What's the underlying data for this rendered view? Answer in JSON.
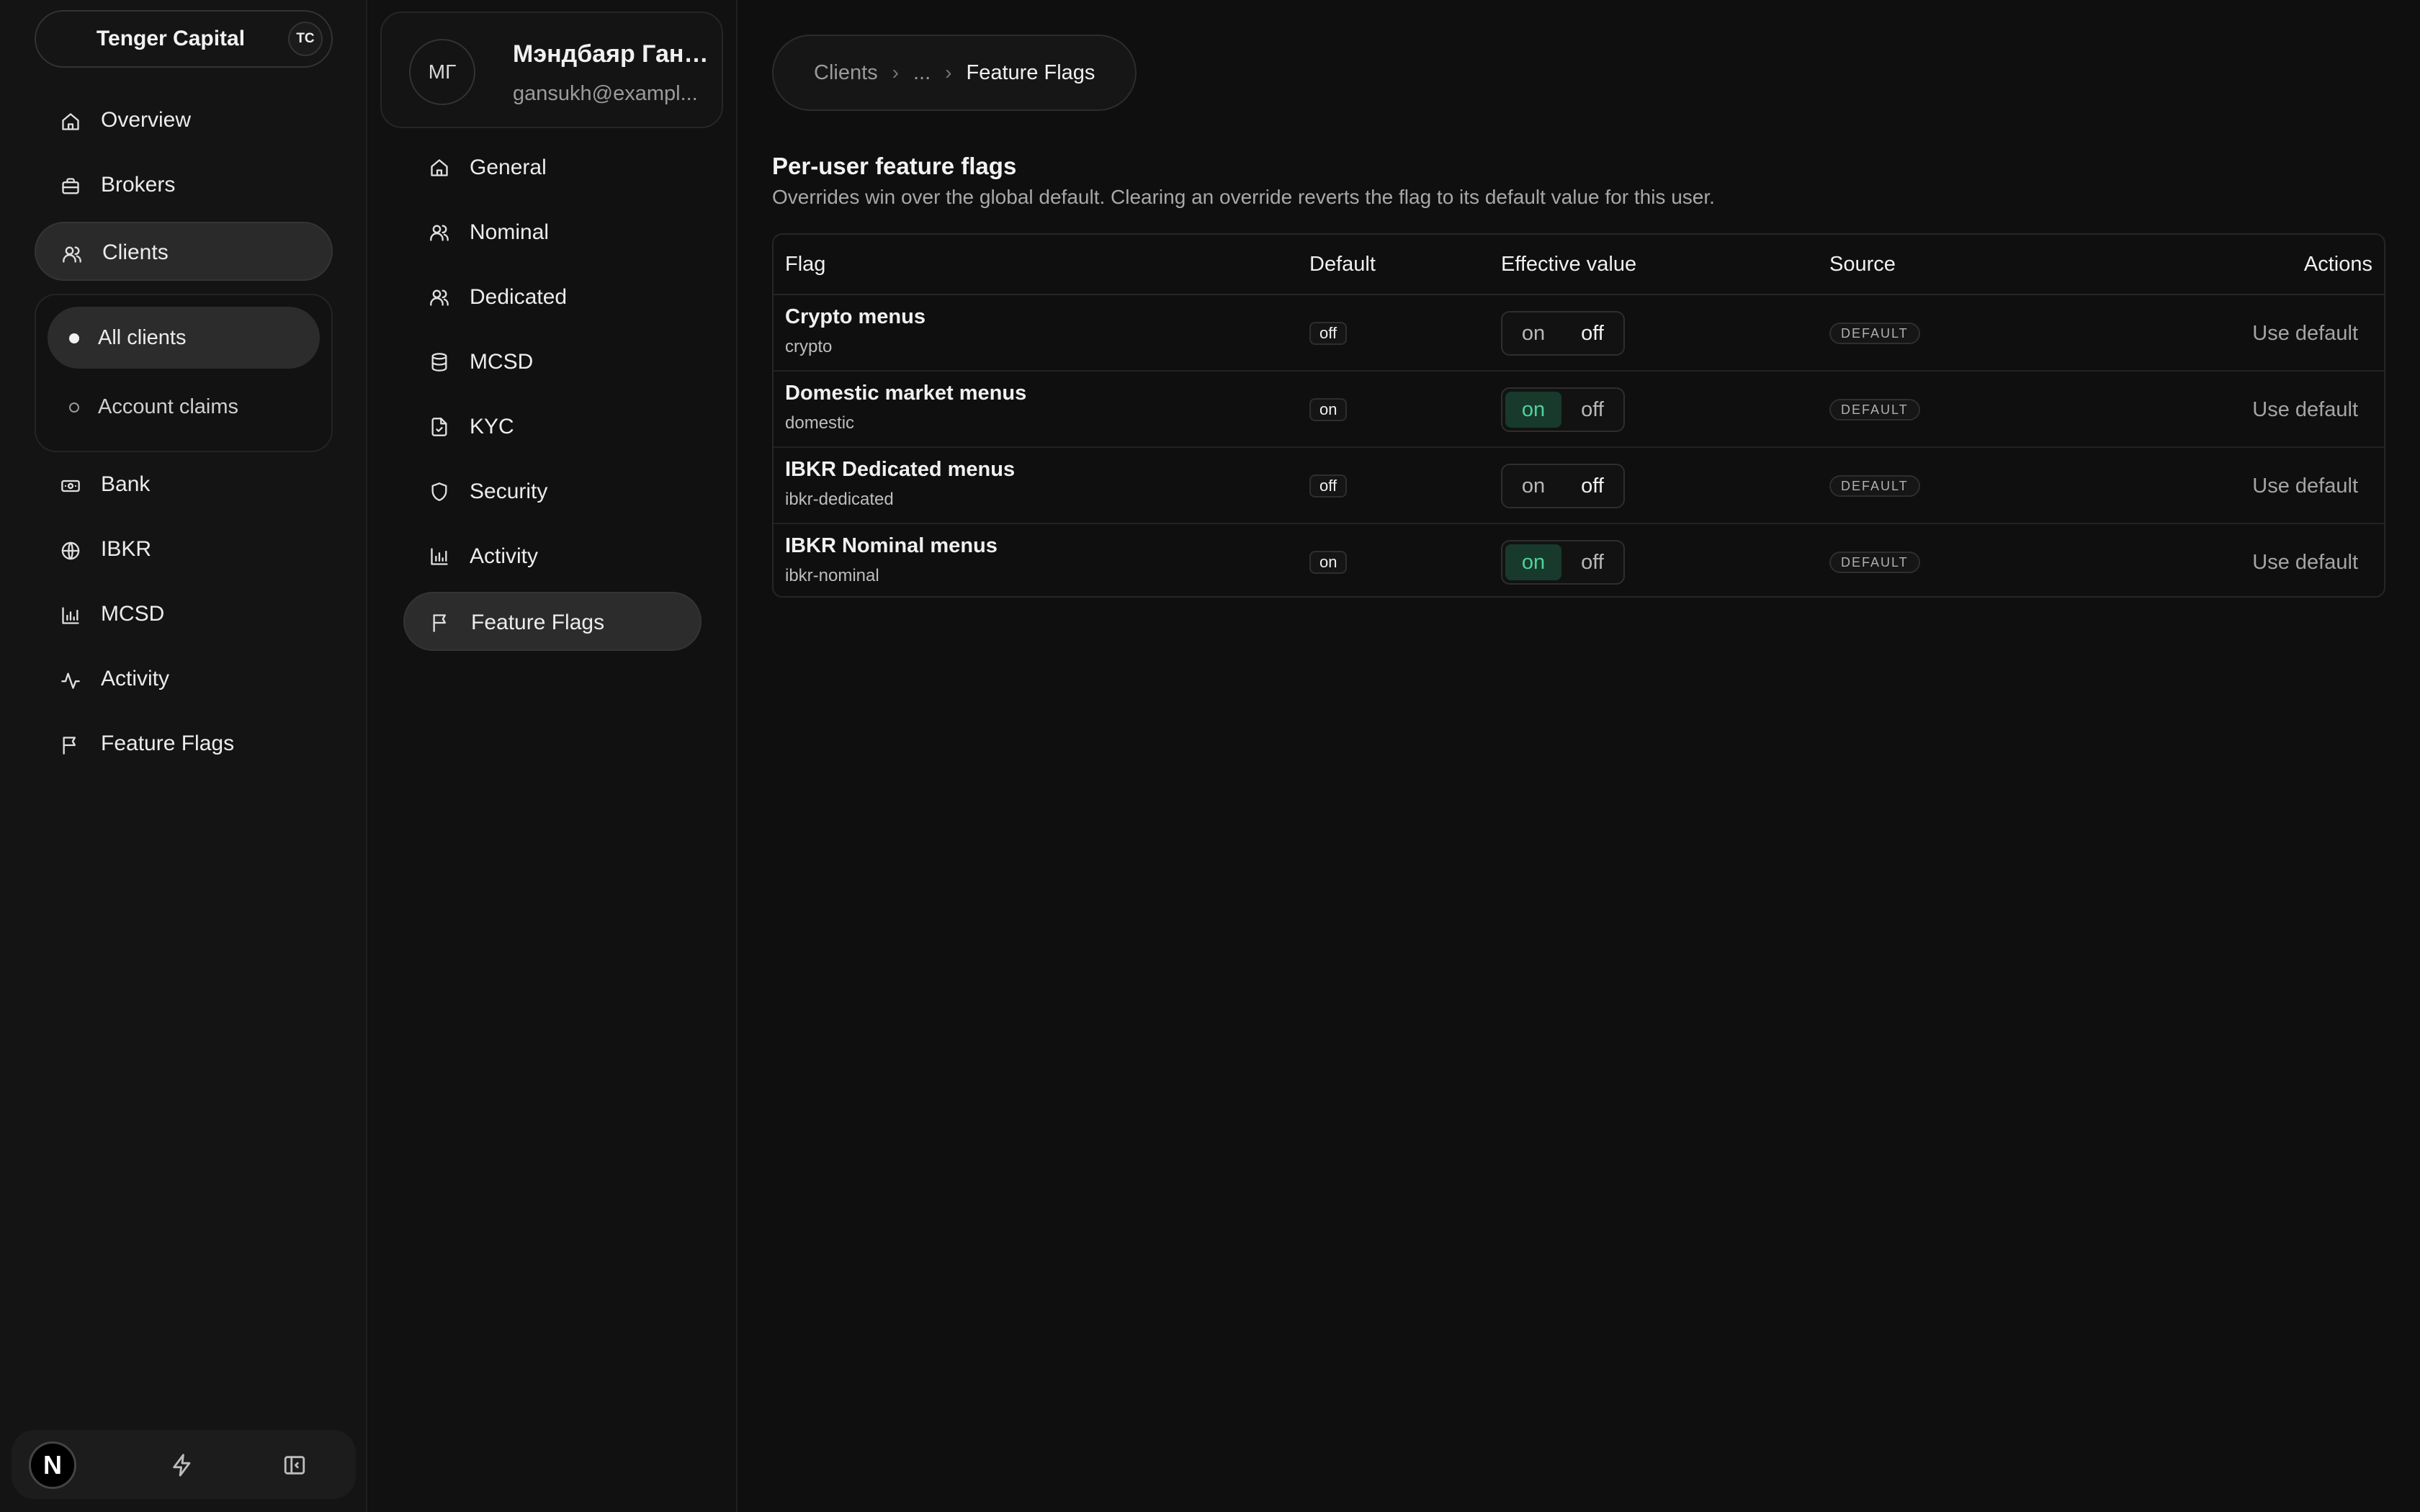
{
  "org": {
    "name": "Tenger Capital",
    "badge": "TC"
  },
  "sidebar": {
    "items": [
      {
        "label": "Overview",
        "icon": "home-icon"
      },
      {
        "label": "Brokers",
        "icon": "briefcase-icon"
      },
      {
        "label": "Clients",
        "icon": "users-icon"
      },
      {
        "label": "Bank",
        "icon": "banknote-icon"
      },
      {
        "label": "IBKR",
        "icon": "globe-icon"
      },
      {
        "label": "MCSD",
        "icon": "bar-chart-icon"
      },
      {
        "label": "Activity",
        "icon": "activity-icon"
      },
      {
        "label": "Feature Flags",
        "icon": "flag-icon"
      }
    ],
    "clients_sub": [
      {
        "label": "All clients"
      },
      {
        "label": "Account claims"
      }
    ],
    "footer": {
      "logo": "N"
    }
  },
  "user": {
    "initials": "МГ",
    "name": "Мэндбаяр Ганс...",
    "email": "gansukh@exampl..."
  },
  "client_nav": [
    {
      "label": "General",
      "icon": "home-icon"
    },
    {
      "label": "Nominal",
      "icon": "users-icon"
    },
    {
      "label": "Dedicated",
      "icon": "users-icon"
    },
    {
      "label": "MCSD",
      "icon": "database-icon"
    },
    {
      "label": "KYC",
      "icon": "file-check-icon"
    },
    {
      "label": "Security",
      "icon": "shield-icon"
    },
    {
      "label": "Activity",
      "icon": "bar-chart-icon"
    },
    {
      "label": "Feature Flags",
      "icon": "flag-icon"
    }
  ],
  "breadcrumb": {
    "root": "Clients",
    "ellipsis": "...",
    "sep": "›",
    "current": "Feature Flags"
  },
  "section": {
    "title": "Per-user feature flags",
    "subtitle": "Overrides win over the global default. Clearing an override reverts the flag to its default value for this user."
  },
  "table": {
    "headers": {
      "flag": "Flag",
      "default": "Default",
      "effective": "Effective value",
      "source": "Source",
      "actions": "Actions"
    },
    "rows": [
      {
        "name": "Crypto menus",
        "key": "crypto",
        "default": "off",
        "on_label": "on",
        "off_label": "off",
        "effective": "off",
        "source": "DEFAULT",
        "action": "Use default"
      },
      {
        "name": "Domestic market menus",
        "key": "domestic",
        "default": "on",
        "on_label": "on",
        "off_label": "off",
        "effective": "on",
        "source": "DEFAULT",
        "action": "Use default"
      },
      {
        "name": "IBKR Dedicated menus",
        "key": "ibkr-dedicated",
        "default": "off",
        "on_label": "on",
        "off_label": "off",
        "effective": "off",
        "source": "DEFAULT",
        "action": "Use default"
      },
      {
        "name": "IBKR Nominal menus",
        "key": "ibkr-nominal",
        "default": "on",
        "on_label": "on",
        "off_label": "off",
        "effective": "on",
        "source": "DEFAULT",
        "action": "Use default"
      }
    ]
  },
  "colors": {
    "accent_on_bg": "#173a2c",
    "accent_on_text": "#4fd39a",
    "background": "#0f0f0f"
  }
}
